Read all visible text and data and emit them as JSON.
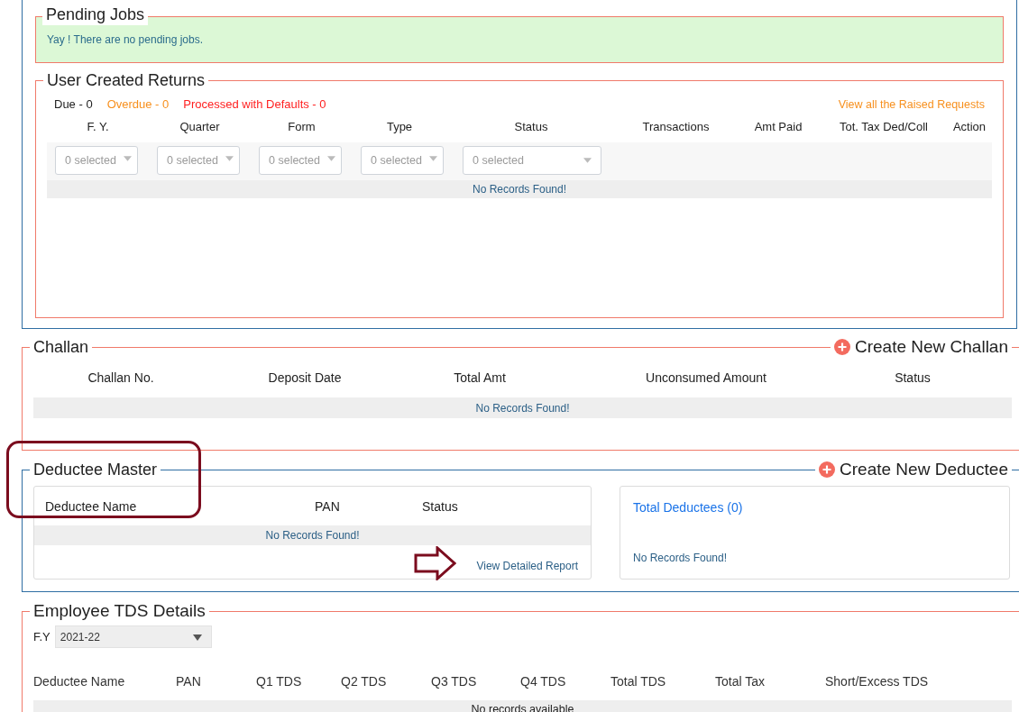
{
  "pending_jobs": {
    "title": "Pending Jobs",
    "message": "Yay ! There are no pending jobs."
  },
  "user_created_returns": {
    "title": "User Created Returns",
    "counts": [
      {
        "label": "Due - 0",
        "color": "#222222"
      },
      {
        "label": "Overdue - 0",
        "color": "#f7901e"
      },
      {
        "label": "Processed with Defaults - 0",
        "color": "#ff1f1f"
      }
    ],
    "link": "View all the Raised Requests",
    "columns": [
      "F. Y.",
      "Quarter",
      "Form",
      "Type",
      "Status",
      "Transactions",
      "Amt Paid",
      "Tot. Tax Ded/Coll",
      "Action"
    ],
    "filters": [
      {
        "value": "0 selected"
      },
      {
        "value": "0 selected"
      },
      {
        "value": "0 selected"
      },
      {
        "value": "0 selected"
      },
      {
        "value": "0 selected"
      }
    ],
    "empty": "No Records Found!"
  },
  "challan": {
    "title": "Challan",
    "action": "Create New Challan",
    "columns": [
      "Challan No.",
      "Deposit Date",
      "Total Amt",
      "Unconsumed Amount",
      "Status"
    ],
    "empty": "No Records Found!"
  },
  "deductee_master": {
    "title": "Deductee Master",
    "action": "Create New Deductee",
    "columns": [
      "Deductee Name",
      "PAN",
      "Status"
    ],
    "empty": "No Records Found!",
    "report_link": "View Detailed Report",
    "summary": {
      "title": "Total Deductees (0)",
      "empty": "No Records Found!"
    }
  },
  "employee_tds": {
    "title": "Employee TDS Details",
    "fy_label": "F.Y",
    "fy_value": "2021-22",
    "columns": [
      "Deductee Name",
      "PAN",
      "Q1 TDS",
      "Q2 TDS",
      "Q3 TDS",
      "Q4 TDS",
      "Total TDS",
      "Total Tax",
      "Short/Excess TDS"
    ],
    "empty": "No records available"
  }
}
